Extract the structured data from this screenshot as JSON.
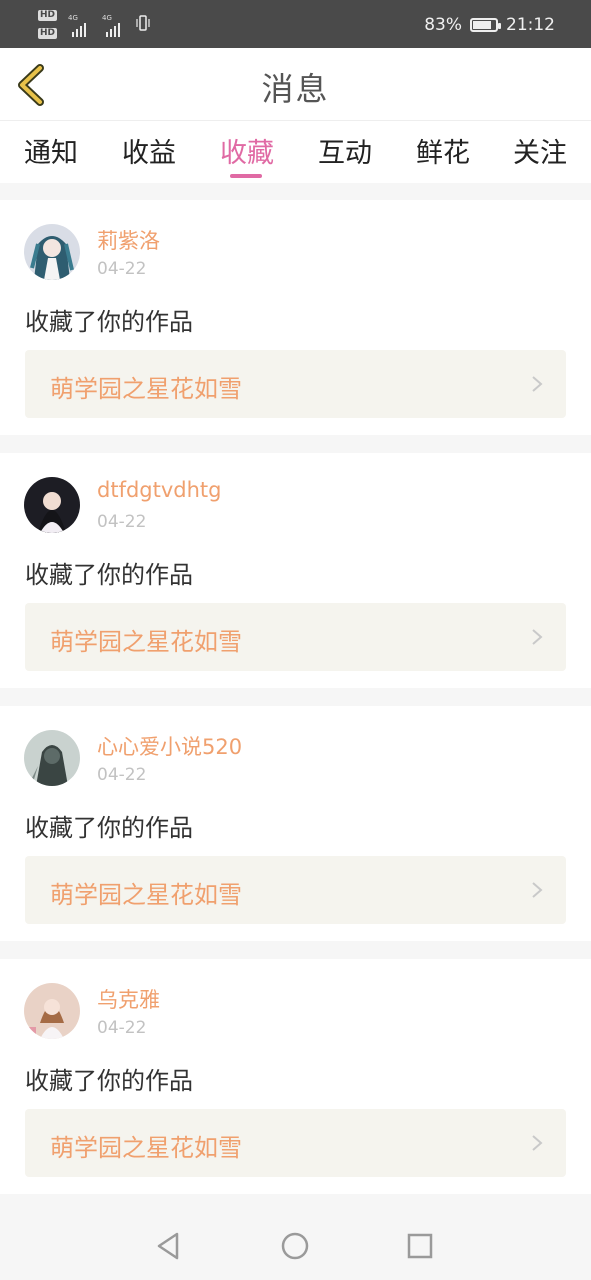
{
  "status_bar": {
    "hd1": "HD",
    "hd2": "HD",
    "net1": "4G",
    "net2": "4G",
    "battery_percent": "83%",
    "battery_level": 0.83,
    "time": "21:12"
  },
  "header": {
    "title": "消息",
    "back_icon": "chevron-left-icon"
  },
  "tabs": [
    {
      "label": "通知",
      "active": false
    },
    {
      "label": "收益",
      "active": false
    },
    {
      "label": "收藏",
      "active": true
    },
    {
      "label": "互动",
      "active": false
    },
    {
      "label": "鲜花",
      "active": false
    },
    {
      "label": "关注",
      "active": false
    }
  ],
  "colors": {
    "accent": "#e06aa4",
    "username": "#f0a06e",
    "work_bg": "#f5f4ee"
  },
  "feed": [
    {
      "user": "莉紫洛",
      "date": "04-22",
      "action": "收藏了你的作品",
      "work_title": "萌学园之星花如雪"
    },
    {
      "user": "dtfdgtvdhtg",
      "date": "04-22",
      "action": "收藏了你的作品",
      "work_title": "萌学园之星花如雪"
    },
    {
      "user": "心心爱小说520",
      "date": "04-22",
      "action": "收藏了你的作品",
      "work_title": "萌学园之星花如雪"
    },
    {
      "user": "乌克雅",
      "date": "04-22",
      "action": "收藏了你的作品",
      "work_title": "萌学园之星花如雪"
    }
  ],
  "nav_bar": {
    "back": "triangle-back-icon",
    "home": "circle-home-icon",
    "recents": "square-recents-icon"
  }
}
